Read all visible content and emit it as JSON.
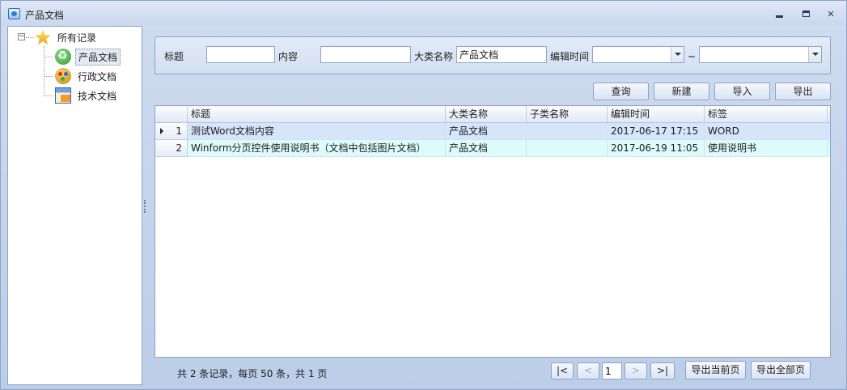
{
  "window": {
    "title": "产品文档"
  },
  "tree": {
    "root": "所有记录",
    "children": [
      "产品文档",
      "行政文档",
      "技术文档"
    ],
    "selected": "产品文档"
  },
  "filter": {
    "title_label": "标题",
    "title_value": "",
    "content_label": "内容",
    "content_value": "",
    "category_label": "大类名称",
    "category_value": "产品文档",
    "edit_time_label": "编辑时间",
    "date_from": "",
    "range_sep": "~",
    "date_to": ""
  },
  "toolbar": {
    "query": "查询",
    "new": "新建",
    "import": "导入",
    "export": "导出"
  },
  "grid": {
    "columns": [
      "标题",
      "大类名称",
      "子类名称",
      "编辑时间",
      "标签"
    ],
    "rows": [
      {
        "num": "1",
        "title": "测试Word文档内容",
        "category": "产品文档",
        "subcategory": "",
        "time": "2017-06-17 17:15",
        "tag": "WORD"
      },
      {
        "num": "2",
        "title": "Winform分页控件使用说明书（文档中包括图片文档）",
        "category": "产品文档",
        "subcategory": "",
        "time": "2017-06-19 11:05",
        "tag": "使用说明书"
      }
    ]
  },
  "pager": {
    "info": "共 2 条记录，每页 50 条，共 1 页",
    "first": "|<",
    "prev": "<",
    "page": "1",
    "next": ">",
    "last": ">|",
    "export_current": "导出当前页",
    "export_all": "导出全部页"
  },
  "colors": {
    "row_selected": "#d5e6fa",
    "row_alt": "#dcfbfb",
    "frame": "#bccde8"
  }
}
